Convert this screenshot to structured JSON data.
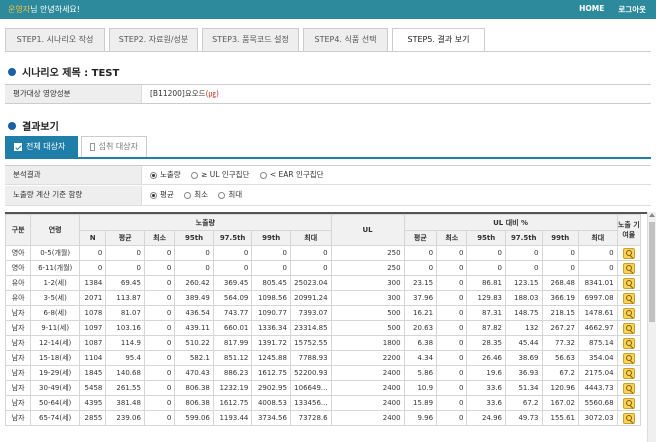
{
  "header": {
    "user_name": "운영자",
    "greeting_suffix": "님 안녕하세요!",
    "home_link": "HOME",
    "logout_link": "로그아웃"
  },
  "tabs": [
    {
      "label": "STEP1. 시나리오 작성",
      "active": false
    },
    {
      "label": "STEP2. 자료원/성분",
      "active": false
    },
    {
      "label": "STEP3. 품목코드 설정",
      "active": false
    },
    {
      "label": "STEP4. 식품 선택",
      "active": false
    },
    {
      "label": "STEP5. 결과 보기",
      "active": true
    }
  ],
  "scenario": {
    "title": "시나리오 제목 : TEST",
    "nutrient_label": "평가대상 영양성분",
    "nutrient_code": "[B11200]요오드",
    "nutrient_unit": "(㎍)"
  },
  "results": {
    "title": "결과보기",
    "subtab_all": "전체 대상자",
    "subtab_intake": "섭취 대상자",
    "analysis_label": "분석결과",
    "analysis_options": [
      "노출량",
      "≥ UL 인구집단",
      "< EAR 인구집단"
    ],
    "analysis_selected": 0,
    "basis_label": "노출량 계산 기준 함량",
    "basis_options": [
      "평균",
      "최소",
      "최대"
    ],
    "basis_selected": 0
  },
  "table": {
    "headers": {
      "gender": "구분",
      "age": "연령",
      "exposure_group": "노출량",
      "ul": "UL",
      "ul_ratio_group": "UL 대비 %",
      "contribution": "노출 기여율",
      "sub": [
        "N",
        "평균",
        "최소",
        "95th",
        "97.5th",
        "99th",
        "최대"
      ],
      "ul_sub": [
        "평균",
        "최소",
        "95th",
        "97.5th",
        "99th",
        "최대"
      ]
    },
    "rows": [
      {
        "gender": "영아",
        "age": "0-5(개월)",
        "n": "0",
        "mean": "0",
        "min": "0",
        "p95": "0",
        "p975": "0",
        "p99": "0",
        "max": "0",
        "ul": "250",
        "r_mean": "0",
        "r_min": "0",
        "r_p95": "0",
        "r_p975": "0",
        "r_p99": "0",
        "r_max": "0"
      },
      {
        "gender": "영아",
        "age": "6-11(개월)",
        "n": "0",
        "mean": "0",
        "min": "0",
        "p95": "0",
        "p975": "0",
        "p99": "0",
        "max": "0",
        "ul": "250",
        "r_mean": "0",
        "r_min": "0",
        "r_p95": "0",
        "r_p975": "0",
        "r_p99": "0",
        "r_max": "0"
      },
      {
        "gender": "유아",
        "age": "1-2(세)",
        "n": "1384",
        "mean": "69.45",
        "min": "0",
        "p95": "260.42",
        "p975": "369.45",
        "p99": "805.45",
        "max": "25023.04",
        "ul": "300",
        "r_mean": "23.15",
        "r_min": "0",
        "r_p95": "86.81",
        "r_p975": "123.15",
        "r_p99": "268.48",
        "r_max": "8341.01"
      },
      {
        "gender": "유아",
        "age": "3-5(세)",
        "n": "2071",
        "mean": "113.87",
        "min": "0",
        "p95": "389.49",
        "p975": "564.09",
        "p99": "1098.56",
        "max": "20991.24",
        "ul": "300",
        "r_mean": "37.96",
        "r_min": "0",
        "r_p95": "129.83",
        "r_p975": "188.03",
        "r_p99": "366.19",
        "r_max": "6997.08"
      },
      {
        "gender": "남자",
        "age": "6-8(세)",
        "n": "1078",
        "mean": "81.07",
        "min": "0",
        "p95": "436.54",
        "p975": "743.77",
        "p99": "1090.77",
        "max": "7393.07",
        "ul": "500",
        "r_mean": "16.21",
        "r_min": "0",
        "r_p95": "87.31",
        "r_p975": "148.75",
        "r_p99": "218.15",
        "r_max": "1478.61"
      },
      {
        "gender": "남자",
        "age": "9-11(세)",
        "n": "1097",
        "mean": "103.16",
        "min": "0",
        "p95": "439.11",
        "p975": "660.01",
        "p99": "1336.34",
        "max": "23314.85",
        "ul": "500",
        "r_mean": "20.63",
        "r_min": "0",
        "r_p95": "87.82",
        "r_p975": "132",
        "r_p99": "267.27",
        "r_max": "4662.97"
      },
      {
        "gender": "남자",
        "age": "12-14(세)",
        "n": "1087",
        "mean": "114.9",
        "min": "0",
        "p95": "510.22",
        "p975": "817.99",
        "p99": "1391.72",
        "max": "15752.55",
        "ul": "1800",
        "r_mean": "6.38",
        "r_min": "0",
        "r_p95": "28.35",
        "r_p975": "45.44",
        "r_p99": "77.32",
        "r_max": "875.14"
      },
      {
        "gender": "남자",
        "age": "15-18(세)",
        "n": "1104",
        "mean": "95.4",
        "min": "0",
        "p95": "582.1",
        "p975": "851.12",
        "p99": "1245.88",
        "max": "7788.93",
        "ul": "2200",
        "r_mean": "4.34",
        "r_min": "0",
        "r_p95": "26.46",
        "r_p975": "38.69",
        "r_p99": "56.63",
        "r_max": "354.04"
      },
      {
        "gender": "남자",
        "age": "19-29(세)",
        "n": "1845",
        "mean": "140.68",
        "min": "0",
        "p95": "470.43",
        "p975": "886.23",
        "p99": "1612.75",
        "max": "52200.93",
        "ul": "2400",
        "r_mean": "5.86",
        "r_min": "0",
        "r_p95": "19.6",
        "r_p975": "36.93",
        "r_p99": "67.2",
        "r_max": "2175.04"
      },
      {
        "gender": "남자",
        "age": "30-49(세)",
        "n": "5458",
        "mean": "261.55",
        "min": "0",
        "p95": "806.38",
        "p975": "1232.19",
        "p99": "2902.95",
        "max": "106649...",
        "ul": "2400",
        "r_mean": "10.9",
        "r_min": "0",
        "r_p95": "33.6",
        "r_p975": "51.34",
        "r_p99": "120.96",
        "r_max": "4443.73"
      },
      {
        "gender": "남자",
        "age": "50-64(세)",
        "n": "4395",
        "mean": "381.48",
        "min": "0",
        "p95": "806.38",
        "p975": "1612.75",
        "p99": "4008.53",
        "max": "133456...",
        "ul": "2400",
        "r_mean": "15.89",
        "r_min": "0",
        "r_p95": "33.6",
        "r_p975": "67.2",
        "r_p99": "167.02",
        "r_max": "5560.68"
      },
      {
        "gender": "남자",
        "age": "65-74(세)",
        "n": "2855",
        "mean": "239.06",
        "min": "0",
        "p95": "599.06",
        "p975": "1193.44",
        "p99": "3734.56",
        "max": "73728.6",
        "ul": "2400",
        "r_mean": "9.96",
        "r_min": "0",
        "r_p95": "24.96",
        "r_p975": "49.73",
        "r_p99": "155.61",
        "r_max": "3072.03"
      }
    ]
  }
}
